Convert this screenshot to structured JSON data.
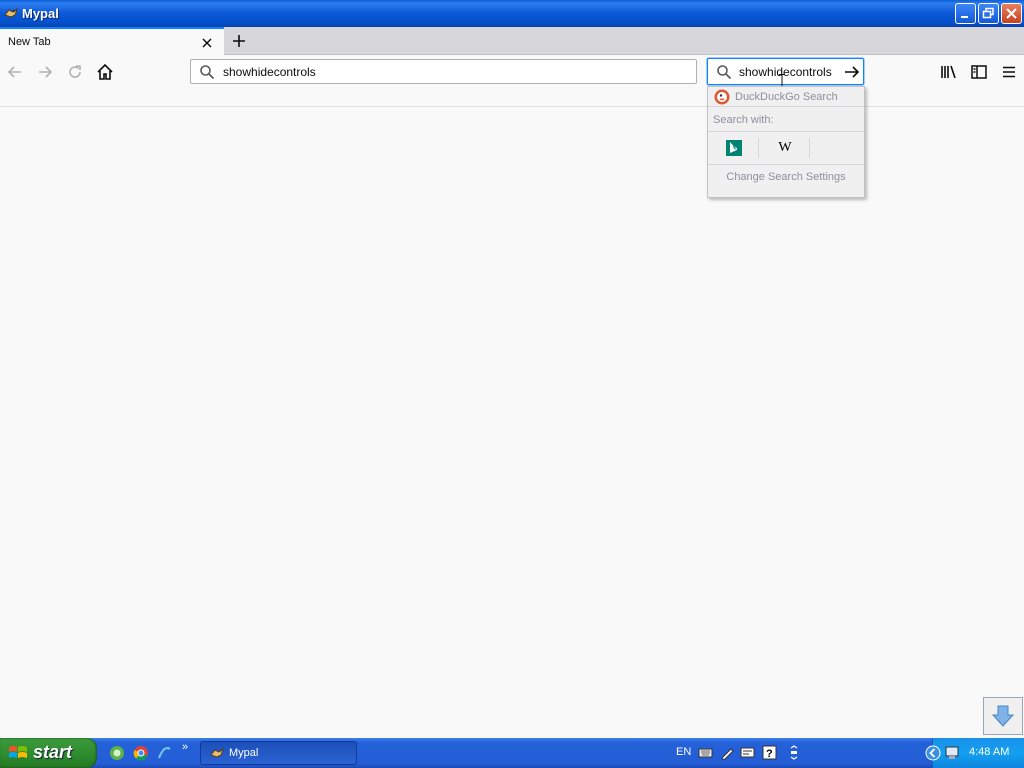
{
  "window": {
    "title": "Mypal"
  },
  "tabs": [
    {
      "label": "New Tab"
    }
  ],
  "urlbar": {
    "value": "showhidecontrols"
  },
  "searchbar": {
    "value": "showhidecontrols"
  },
  "search_popup": {
    "current_engine": "DuckDuckGo Search",
    "search_with_label": "Search with:",
    "alt_engines": [
      "bing-icon",
      "wikipedia-icon"
    ],
    "wikipedia_glyph": "W",
    "change_settings_label": "Change Search Settings"
  },
  "taskbar": {
    "start_label": "start",
    "quick_launch_more": "»",
    "active_task_label": "Mypal",
    "language": "EN",
    "clock": "4:48 AM"
  },
  "colors": {
    "accent": "#0a84ff",
    "taskbar": "#245ed6",
    "start": "#2d8a2d"
  }
}
